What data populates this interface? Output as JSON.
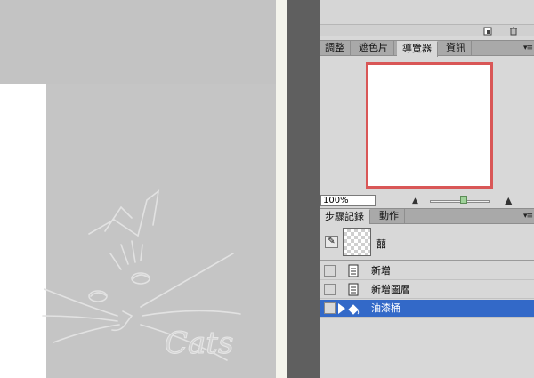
{
  "watermark": {
    "text": "Cats"
  },
  "top_panel": {
    "new_icon": "new-snapshot-icon",
    "trash_icon": "trash-icon"
  },
  "nav_panel": {
    "tabs": [
      {
        "label": "調整",
        "active": false
      },
      {
        "label": "遮色片",
        "active": false
      },
      {
        "label": "導覽器",
        "active": true
      },
      {
        "label": "資訊",
        "active": false
      }
    ],
    "menu_label": "▾≡",
    "zoom_value": "100%",
    "zoom_out_glyph": "▲",
    "zoom_in_glyph": "▲",
    "preview_border_color": "#d95757"
  },
  "history_panel": {
    "tabs": [
      {
        "label": "步驟記錄",
        "active": true
      },
      {
        "label": "動作",
        "active": false
      }
    ],
    "menu_label": "▾≡",
    "snapshot_label": "囍",
    "items": [
      {
        "label": "新增",
        "selected": false
      },
      {
        "label": "新增圖層",
        "selected": false
      },
      {
        "label": "油漆桶",
        "selected": true
      }
    ],
    "selection_color": "#3369c8"
  }
}
